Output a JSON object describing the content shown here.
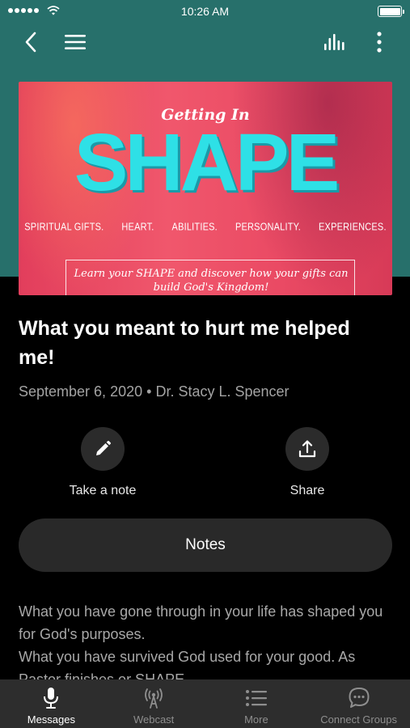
{
  "status_bar": {
    "time": "10:26 AM"
  },
  "artwork": {
    "kicker": "Getting In",
    "title": "SHAPE",
    "subtitle_items": [
      "SPIRITUAL GIFTS.",
      "HEART.",
      "ABILITIES.",
      "PERSONALITY.",
      "EXPERIENCES."
    ],
    "tagline": "Learn your SHAPE and discover how your gifts can build God's Kingdom!"
  },
  "sermon": {
    "title": "What you meant to hurt me helped me!",
    "date": "September 6, 2020",
    "separator": "•",
    "speaker": "Dr. Stacy L. Spencer"
  },
  "actions": {
    "take_note_label": "Take a note",
    "share_label": "Share"
  },
  "notes_button": {
    "label": "Notes"
  },
  "description": {
    "line1": "What you have gone through in your life has shaped you for God's purposes.",
    "line2": "What you have survived God used for your good. As Pastor finishes or SHAPE"
  },
  "tab_bar": {
    "tabs": [
      {
        "label": "Messages",
        "icon": "microphone-icon",
        "active": true
      },
      {
        "label": "Webcast",
        "icon": "broadcast-icon",
        "active": false
      },
      {
        "label": "More",
        "icon": "list-icon",
        "active": false
      },
      {
        "label": "Connect Groups",
        "icon": "chat-bubble-icon",
        "active": false
      }
    ]
  },
  "colors": {
    "header_teal": "#27706b",
    "background": "#000000",
    "surface": "#2b2b2b",
    "artwork_pink": "#f0576c",
    "artwork_cyan": "#2ee0e6",
    "muted_text": "#a3a3a3"
  }
}
